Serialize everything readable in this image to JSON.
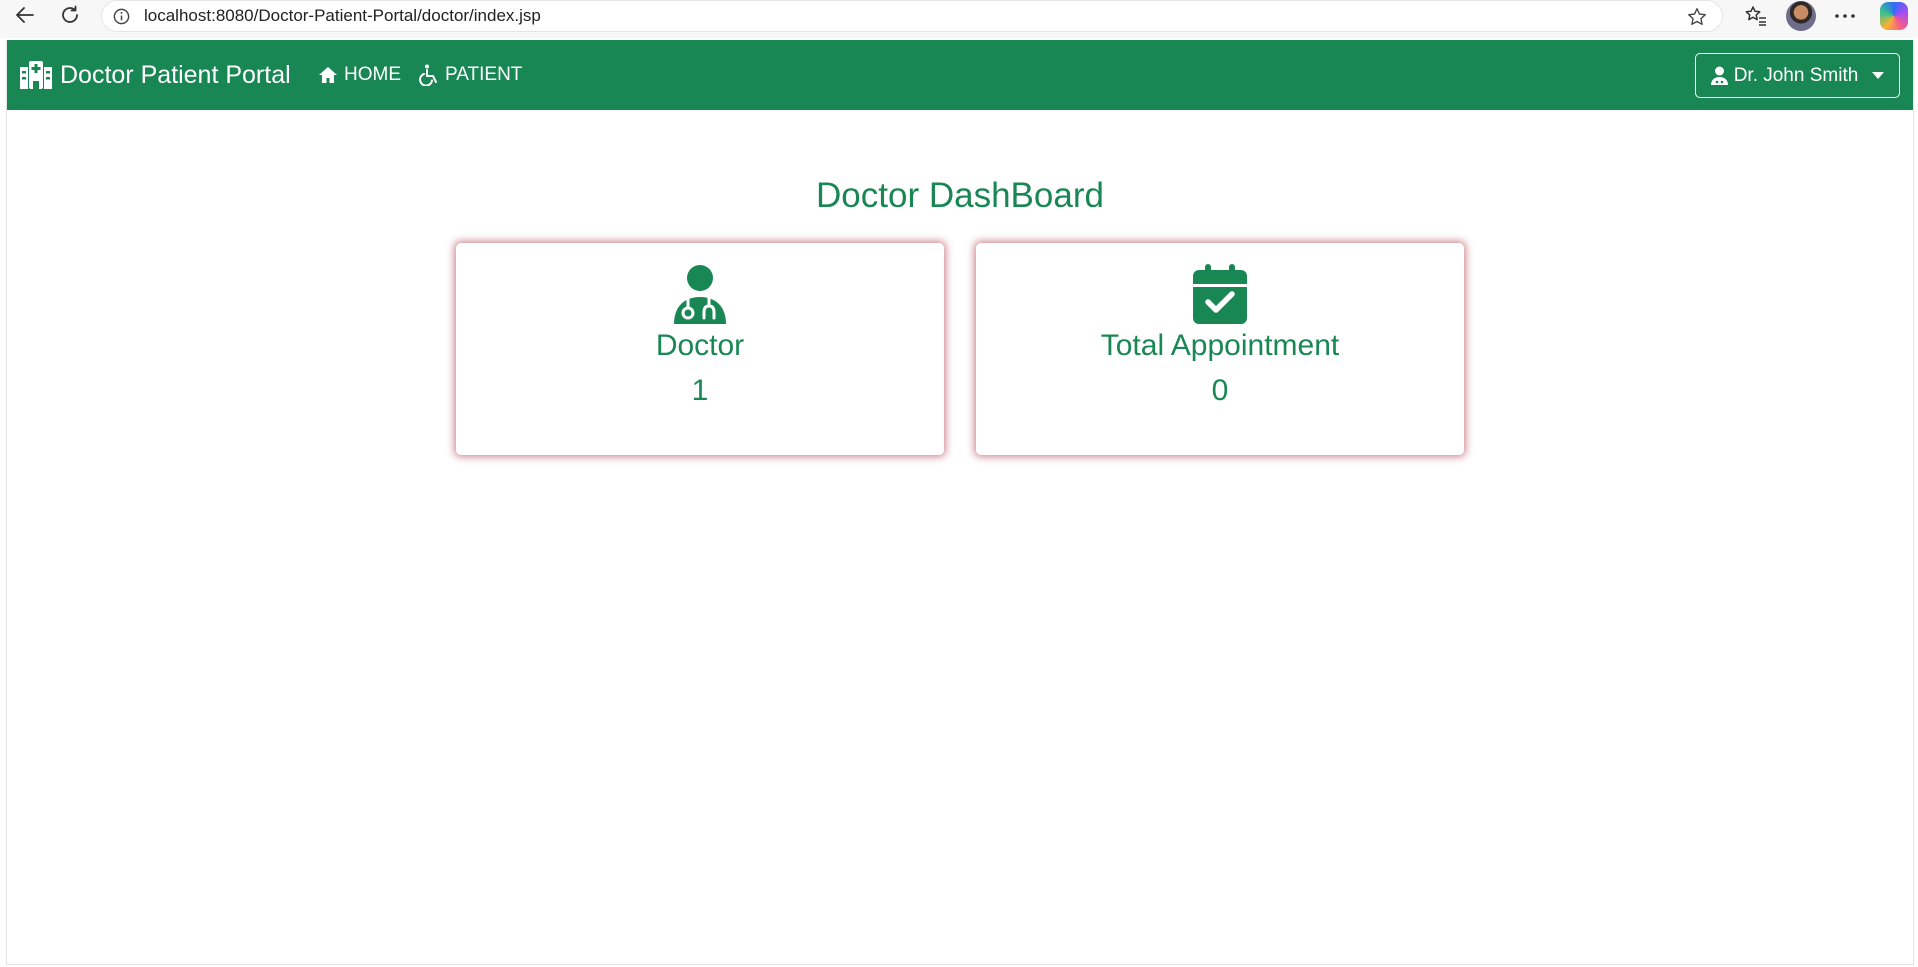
{
  "browser": {
    "url": "localhost:8080/Doctor-Patient-Portal/doctor/index.jsp"
  },
  "navbar": {
    "brand": "Doctor Patient Portal",
    "links": [
      {
        "label": "HOME",
        "icon": "home-icon"
      },
      {
        "label": "PATIENT",
        "icon": "wheelchair-icon"
      }
    ],
    "user_menu": {
      "label": "Dr. John Smith",
      "icon": "user-doctor-icon"
    }
  },
  "dashboard": {
    "title": "Doctor DashBoard",
    "cards": [
      {
        "label": "Doctor",
        "value": "1",
        "icon": "user-doctor-icon"
      },
      {
        "label": "Total Appointment",
        "value": "0",
        "icon": "calendar-check-icon"
      }
    ]
  },
  "colors": {
    "primary": "#198754",
    "card_shadow": "#a52837"
  }
}
